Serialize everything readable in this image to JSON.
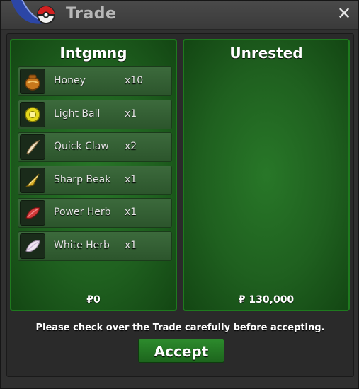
{
  "window": {
    "title": "Trade",
    "close_icon": "close-icon",
    "logo_icon": "pokeball-logo-icon"
  },
  "trade": {
    "left": {
      "name": "Intgmng",
      "money": "₽0",
      "items": [
        {
          "name": "Honey",
          "qty": "x10",
          "icon": "honey-icon"
        },
        {
          "name": "Light Ball",
          "qty": "x1",
          "icon": "light-ball-icon"
        },
        {
          "name": "Quick Claw",
          "qty": "x2",
          "icon": "quick-claw-icon"
        },
        {
          "name": "Sharp Beak",
          "qty": "x1",
          "icon": "sharp-beak-icon"
        },
        {
          "name": "Power Herb",
          "qty": "x1",
          "icon": "power-herb-icon"
        },
        {
          "name": "White Herb",
          "qty": "x1",
          "icon": "white-herb-icon"
        }
      ]
    },
    "right": {
      "name": "Unrested",
      "money": "₽ 130,000",
      "items": []
    },
    "note": "Please check over the Trade carefully before accepting.",
    "accept_label": "Accept"
  },
  "colors": {
    "panel_green": "#1f601f",
    "panel_border": "#1e7a1e",
    "accept_green": "#2c8a2c"
  }
}
